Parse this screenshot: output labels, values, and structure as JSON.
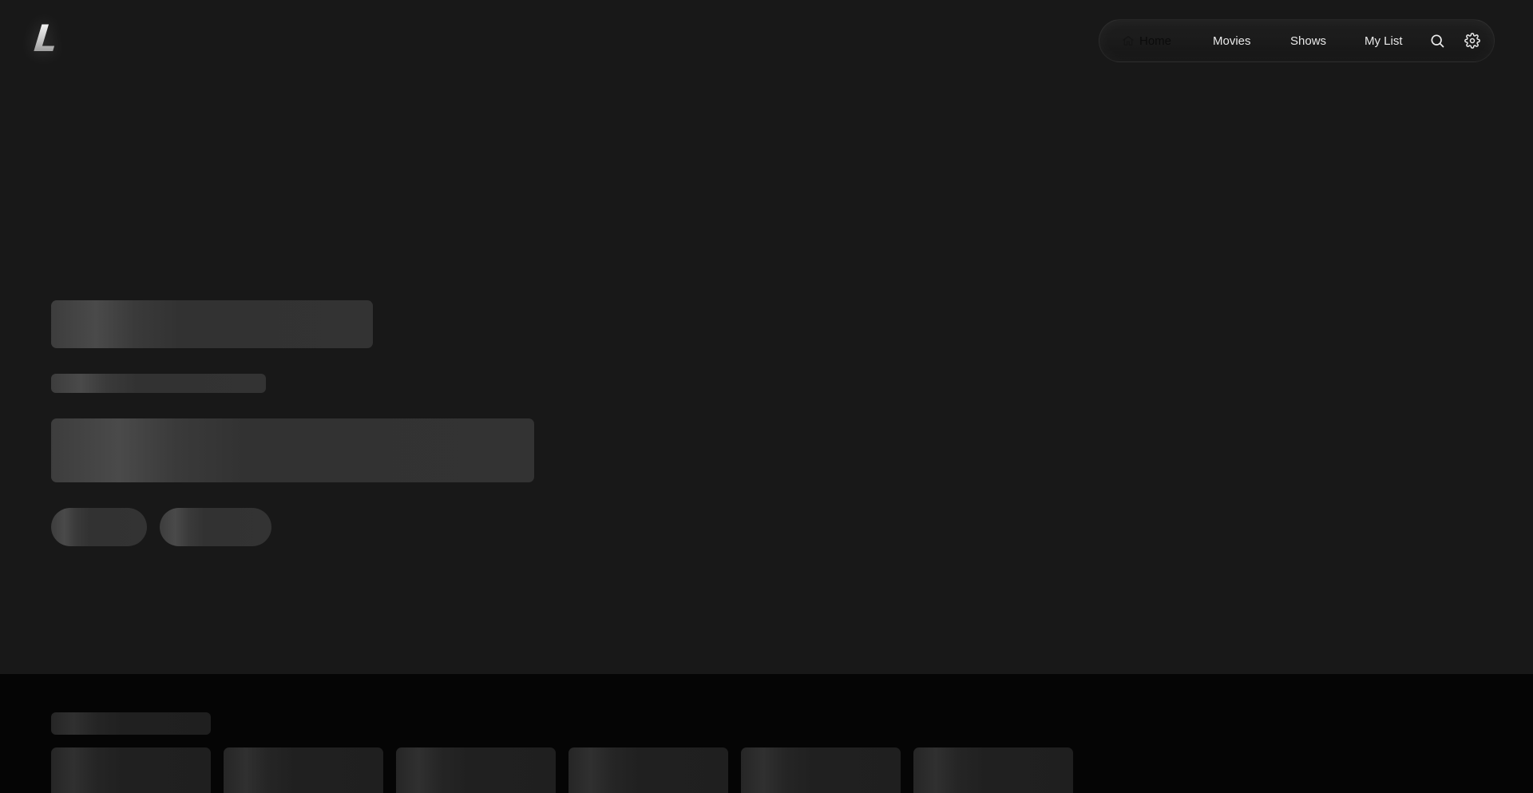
{
  "logo": {
    "text": "L"
  },
  "nav": {
    "items": [
      {
        "label": "Home",
        "icon": "home-icon",
        "active": true
      },
      {
        "label": "Movies",
        "active": false
      },
      {
        "label": "Shows",
        "active": false
      },
      {
        "label": "My List",
        "active": false
      }
    ],
    "search_icon": "search-icon",
    "settings_icon": "gear-icon"
  },
  "colors": {
    "hero_background": "#181818",
    "page_background": "#050505",
    "skeleton": "#3a3a3a",
    "text": "#e9e9e9"
  },
  "state": {
    "loading": true
  }
}
